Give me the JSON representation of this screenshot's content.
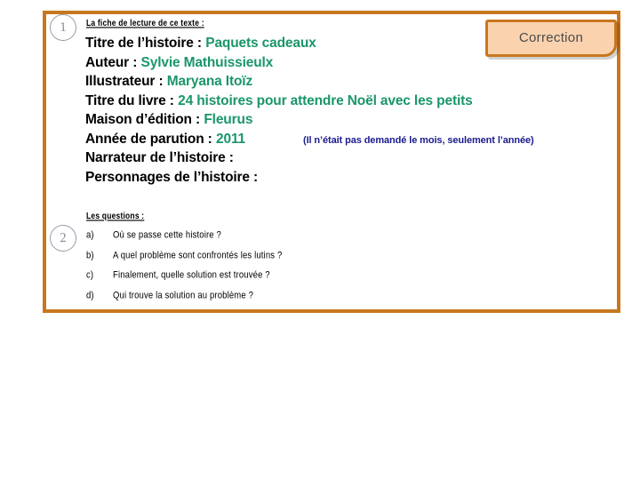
{
  "document": {
    "badge": {
      "label": "Correction"
    },
    "step_numbers": {
      "one": "1",
      "two": "2"
    },
    "fiche": {
      "heading": "La fiche de lecture de ce texte :",
      "rows": [
        {
          "label": "Titre de l’histoire :",
          "value": "Paquets cadeaux",
          "note": ""
        },
        {
          "label": "Auteur :",
          "value": "Sylvie Mathuissieulx",
          "note": ""
        },
        {
          "label": "Illustrateur :",
          "value": "Maryana Itoïz",
          "note": ""
        },
        {
          "label": "Titre du livre :",
          "value": "24 histoires pour attendre Noël avec les petits",
          "note": ""
        },
        {
          "label": "Maison d’édition :",
          "value": "Fleurus",
          "note": ""
        },
        {
          "label": "Année de parution :",
          "value": "2011",
          "note": "(Il n’était pas demandé le mois, seulement l’année)"
        },
        {
          "label": "Narrateur de l’histoire :",
          "value": "",
          "note": ""
        },
        {
          "label": "Personnages de l’histoire :",
          "value": "",
          "note": ""
        }
      ]
    },
    "questions": {
      "heading": "Les questions :",
      "items": [
        {
          "marker": "a)",
          "text": "Où se passe cette histoire ?"
        },
        {
          "marker": "b)",
          "text": "A quel problème sont confrontés les lutins ?"
        },
        {
          "marker": "c)",
          "text": "Finalement, quelle solution est trouvée ?"
        },
        {
          "marker": "d)",
          "text": "Qui trouve la solution au problème ?"
        }
      ]
    },
    "colors": {
      "frame_border": "#c8771f",
      "badge_fill": "#fad2ae",
      "answer_green": "#1a9669",
      "note_blue": "#1b1b8f",
      "circle_grey": "#8d8a99"
    }
  }
}
